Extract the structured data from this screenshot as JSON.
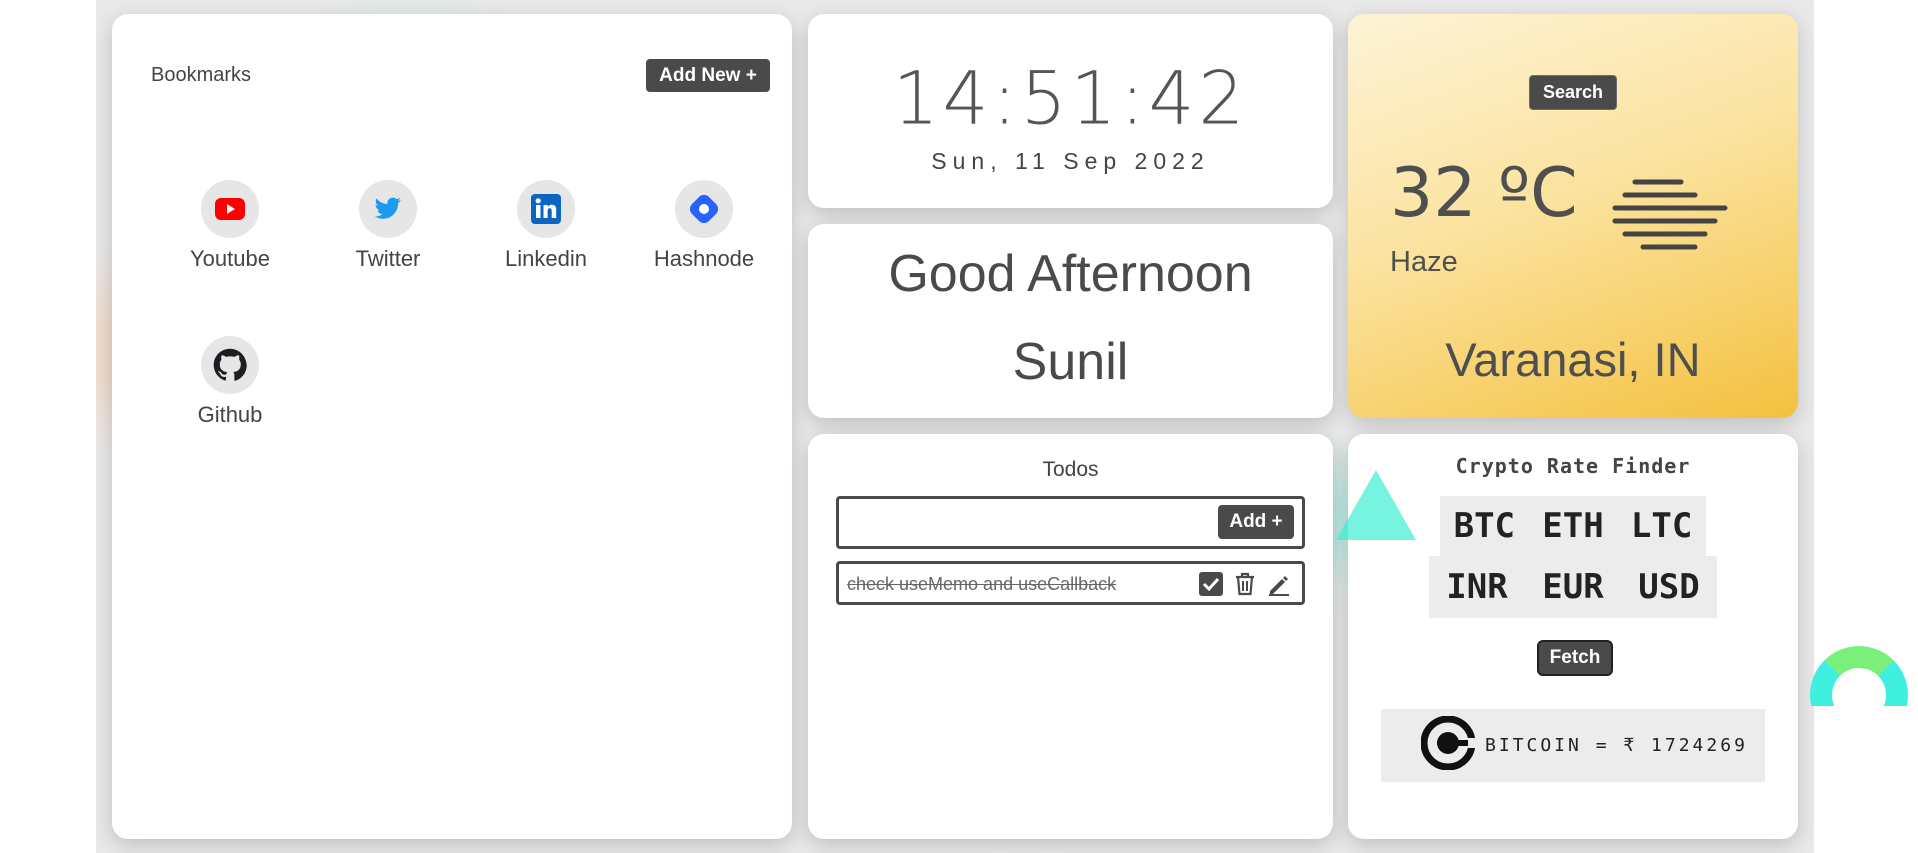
{
  "bookmarks": {
    "title": "Bookmarks",
    "add_label": "Add New +",
    "items": [
      {
        "label": "Youtube",
        "icon": "youtube-icon"
      },
      {
        "label": "Twitter",
        "icon": "twitter-icon"
      },
      {
        "label": "Linkedin",
        "icon": "linkedin-icon"
      },
      {
        "label": "Hashnode",
        "icon": "hashnode-icon"
      },
      {
        "label": "Github",
        "icon": "github-icon"
      }
    ]
  },
  "clock": {
    "time": "14:51:42",
    "date": "Sun, 11 Sep 2022"
  },
  "greeting": {
    "line1": "Good Afternoon",
    "line2": "Sunil"
  },
  "weather": {
    "search_label": "Search",
    "temperature": "32 ºC",
    "condition": "Haze",
    "condition_icon": "haze-icon",
    "location": "Varanasi, IN"
  },
  "todos": {
    "title": "Todos",
    "input_value": "",
    "add_label": "Add +",
    "items": [
      {
        "text": "check useMemo and useCallback",
        "done": true
      }
    ]
  },
  "crypto": {
    "title": "Crypto Rate Finder",
    "coins": [
      "BTC",
      "ETH",
      "LTC"
    ],
    "currencies": [
      "INR",
      "EUR",
      "USD"
    ],
    "fetch_label": "Fetch",
    "result": "BITCOIN = ₹ 1724269"
  },
  "colors": {
    "button_dark": "#4a4a4a",
    "weather_gradient_end": "#f4c13f",
    "youtube_red": "#ff0000",
    "twitter_blue": "#1d9bf0",
    "linkedin_blue": "#0a66c2",
    "hashnode_blue": "#2962ff"
  }
}
